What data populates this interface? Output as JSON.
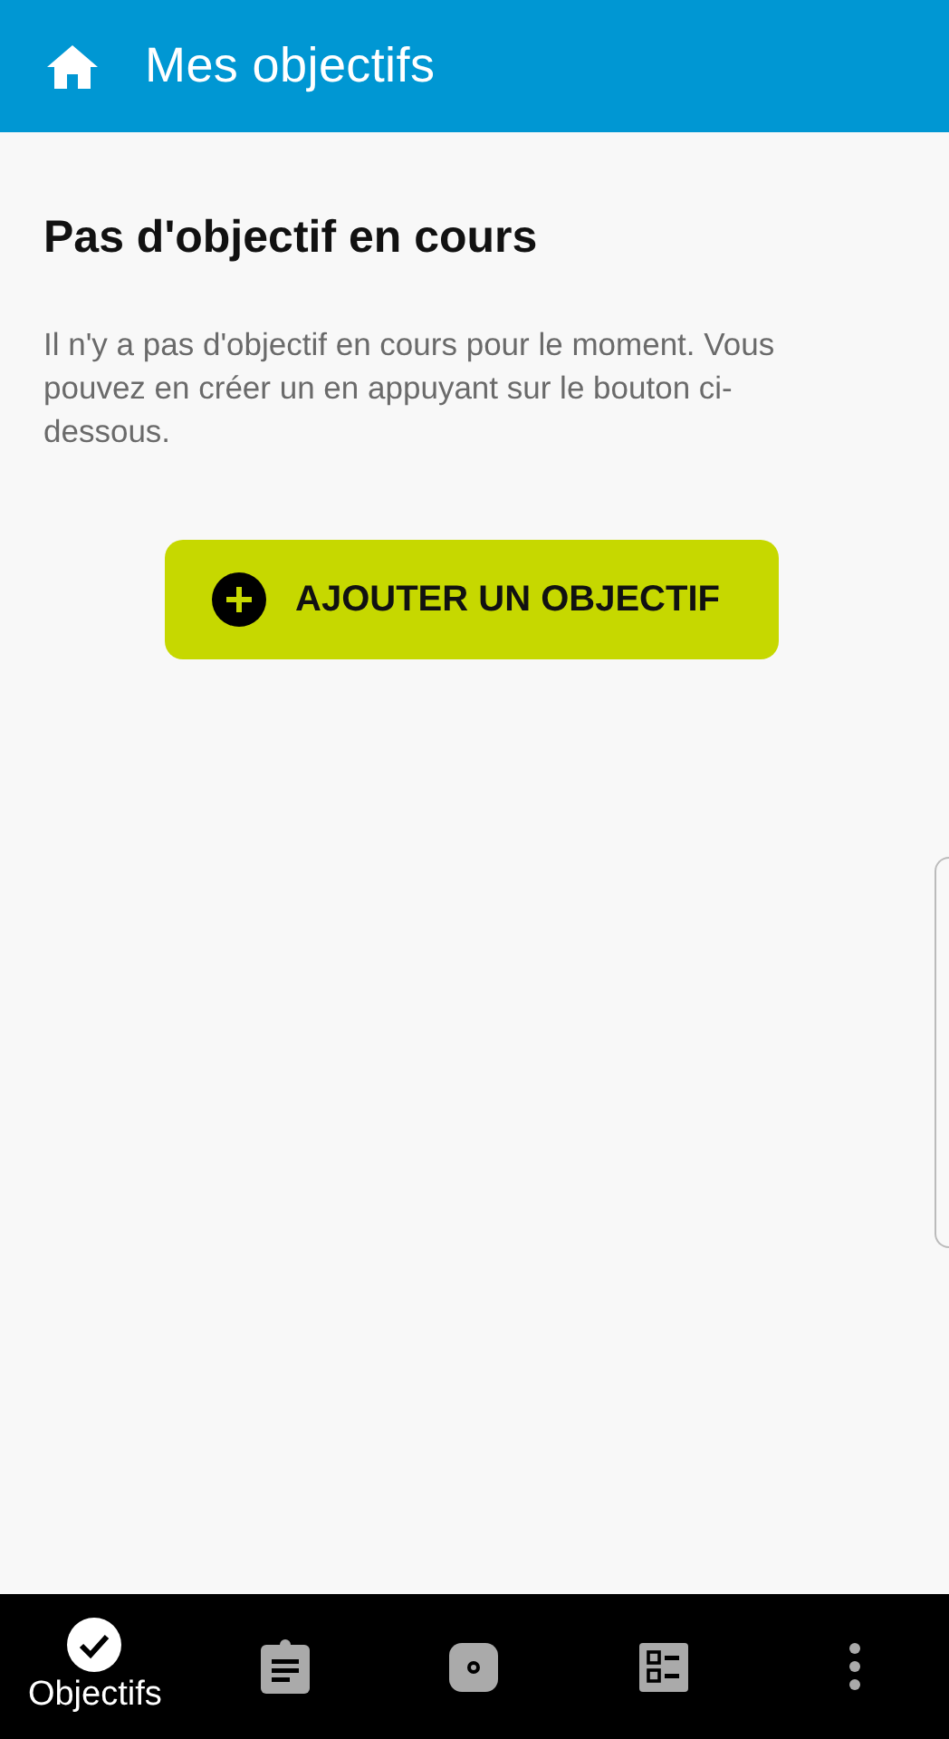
{
  "app_bar": {
    "title": "Mes objectifs"
  },
  "empty_state": {
    "title": "Pas d'objectif en cours",
    "message": "Il n'y a pas d'objectif en cours pour le moment. Vous pouvez en créer un en appuyant sur le bouton ci-dessous.",
    "button": "AJOUTER UN OBJECTIF"
  },
  "bottom_nav": [
    {
      "kind": "goals",
      "label": "Objectifs",
      "selected": true
    },
    {
      "kind": "clipboard",
      "selected": false
    },
    {
      "kind": "disc",
      "selected": false
    },
    {
      "kind": "checklist",
      "selected": false
    },
    {
      "kind": "more",
      "selected": false
    }
  ]
}
